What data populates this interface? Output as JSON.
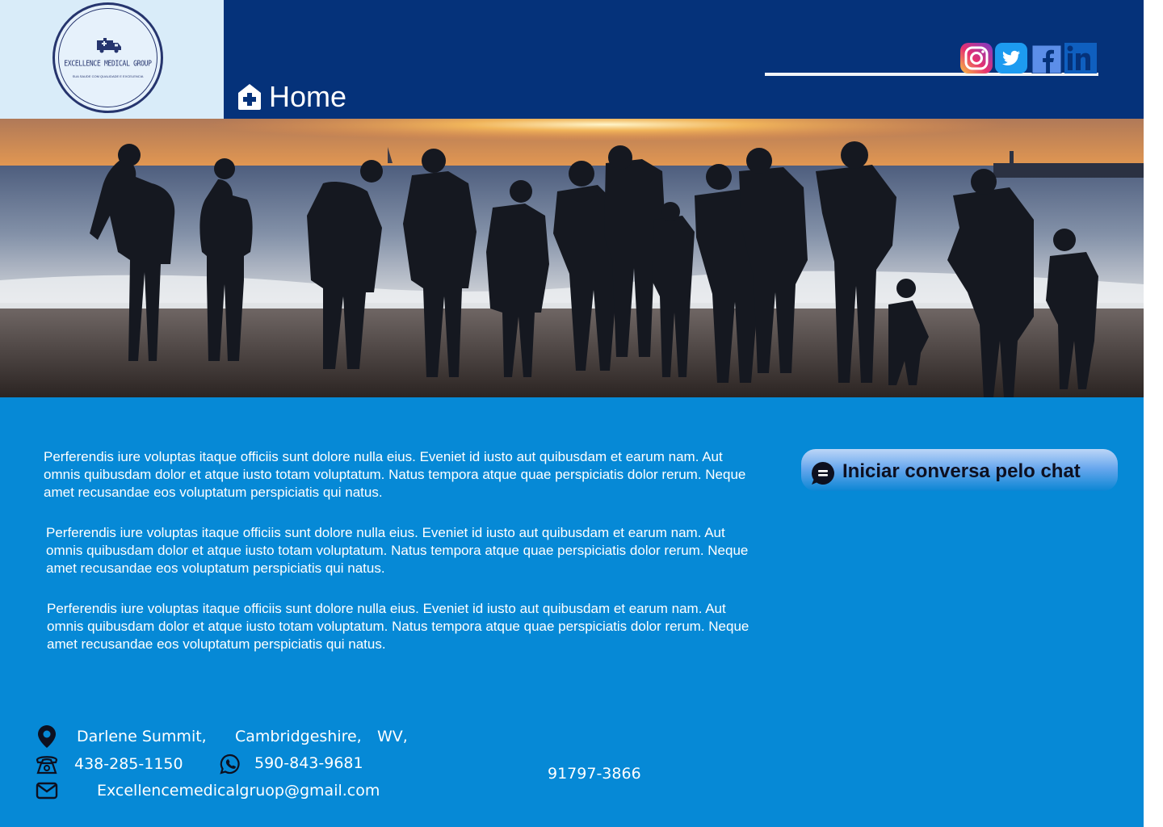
{
  "logo": {
    "name": "EXCELLENCE MEDICAL GROUP",
    "tagline": "SUA SAUDE COM QUALIDADE E EXCELENCIA",
    "icon": "ambulance-icon"
  },
  "nav": {
    "home_label": "Home",
    "home_icon": "house-medical-icon"
  },
  "social": [
    {
      "name": "instagram",
      "icon": "instagram-icon"
    },
    {
      "name": "twitter",
      "icon": "twitter-icon"
    },
    {
      "name": "facebook",
      "icon": "facebook-icon"
    },
    {
      "name": "linkedin",
      "icon": "linkedin-icon"
    }
  ],
  "hero": {
    "image": "family silhouettes on beach at sunset"
  },
  "content": {
    "paragraphs": [
      "Perferendis iure voluptas itaque officiis sunt dolore nulla eius. Eveniet id iusto aut quibusdam et earum nam. Aut omnis quibusdam dolor et atque iusto totam voluptatum. Natus tempora atque quae perspiciatis dolor rerum. Neque amet recusandae eos voluptatum perspiciatis qui natus.",
      "Perferendis iure voluptas itaque officiis sunt dolore nulla eius. Eveniet id iusto aut quibusdam et earum nam. Aut omnis quibusdam dolor et atque iusto totam voluptatum. Natus tempora atque quae perspiciatis dolor rerum. Neque amet recusandae eos voluptatum perspiciatis qui natus.",
      "Perferendis iure voluptas itaque officiis sunt dolore nulla eius. Eveniet id iusto aut quibusdam et earum nam. Aut omnis quibusdam dolor et atque iusto totam voluptatum. Natus tempora atque quae perspiciatis dolor rerum. Neque amet recusandae eos voluptatum perspiciatis qui natus."
    ]
  },
  "chat": {
    "label": "Iniciar conversa pelo chat",
    "icon": "chat-bubble-icon"
  },
  "footer": {
    "address_parts": [
      "Darlene Summit,",
      "Cambridgeshire,",
      "WV,"
    ],
    "zip": "91797-3866",
    "phone": "438-285-1150",
    "whatsapp": "590-843-9681",
    "email": "Excellencemedicalgruop@gmail.com"
  },
  "colors": {
    "header": "#05327a",
    "main": "#0689d6",
    "logo_bg": "#d9ecf9"
  }
}
